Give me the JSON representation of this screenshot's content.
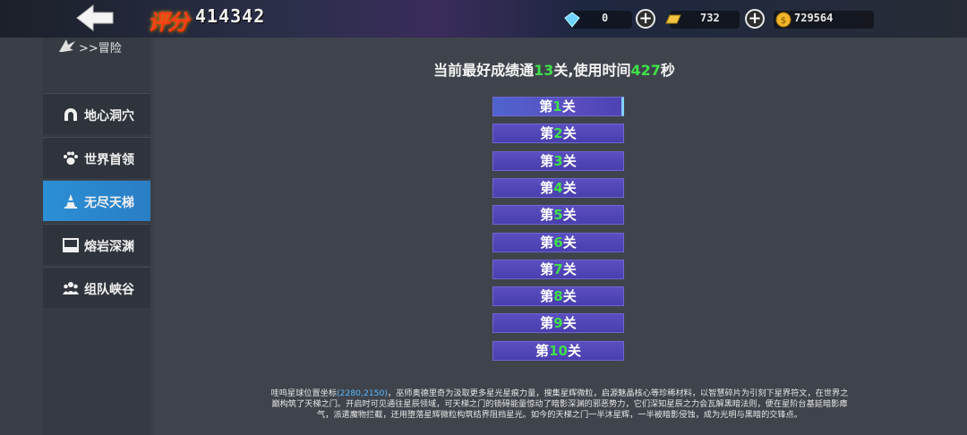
{
  "topbar": {
    "score_label": "评分",
    "score_value": "414342",
    "diamond": "0",
    "gold_bar": "732",
    "coins": "729564",
    "icons": [
      "back-arrow-icon",
      "diamond-icon",
      "plus-icon",
      "gold-bar-icon",
      "plus-icon",
      "coin-icon"
    ]
  },
  "breadcrumb": ">>冒险",
  "sidebar": {
    "items": [
      {
        "label": "地心洞穴",
        "icon": "arch-icon",
        "active": false
      },
      {
        "label": "世界首领",
        "icon": "paw-icon",
        "active": false
      },
      {
        "label": "无尽天梯",
        "icon": "cone-icon",
        "active": true
      },
      {
        "label": "熔岩深渊",
        "icon": "window-icon",
        "active": false
      },
      {
        "label": "组队峡谷",
        "icon": "team-icon",
        "active": false
      }
    ]
  },
  "best": {
    "prefix": "当前最好成绩通",
    "levels": "13",
    "mid": "关,使用时间",
    "seconds": "427",
    "suffix": "秒"
  },
  "levels": [
    {
      "pre": "第",
      "num": "1",
      "post": "关",
      "selected": true
    },
    {
      "pre": "第",
      "num": "2",
      "post": "关",
      "selected": false
    },
    {
      "pre": "第",
      "num": "3",
      "post": "关",
      "selected": false
    },
    {
      "pre": "第",
      "num": "4",
      "post": "关",
      "selected": false
    },
    {
      "pre": "第",
      "num": "5",
      "post": "关",
      "selected": false
    },
    {
      "pre": "第",
      "num": "6",
      "post": "关",
      "selected": false
    },
    {
      "pre": "第",
      "num": "7",
      "post": "关",
      "selected": false
    },
    {
      "pre": "第",
      "num": "8",
      "post": "关",
      "selected": false
    },
    {
      "pre": "第",
      "num": "9",
      "post": "关",
      "selected": false
    },
    {
      "pre": "第",
      "num": "10",
      "post": "关",
      "selected": false
    }
  ],
  "description": {
    "part1": "哇呜星球位置坐标",
    "coords": "(2280,2150)",
    "part2": "，巫师奥德里奇为汲取更多星光星痕力量，搜集星辉微粒，启源魅晶核心等珍稀材料，以智慧碎片为引刻下星界符文，在世界之巅构筑了天梯之门。开启时可见通往星辰领域，可天梯之门的锁碍能量惊动了暗影深渊的邪恶势力，它们深知星辰之力会瓦解黑暗法则，便在星阶台基延暗影瘴气，派遣魔物拦截，还用堕落星辉微粒构筑结界阻挡星光。如今的天梯之门一半沐星辉，一半被暗影侵蚀，成为光明与黑暗的交锋点。"
  },
  "colors": {
    "accent_blue": "#2b8fd6",
    "level_purple": "#5a4ec0",
    "highlight_green": "#3fe04a",
    "coord_blue": "#57b8ff"
  }
}
